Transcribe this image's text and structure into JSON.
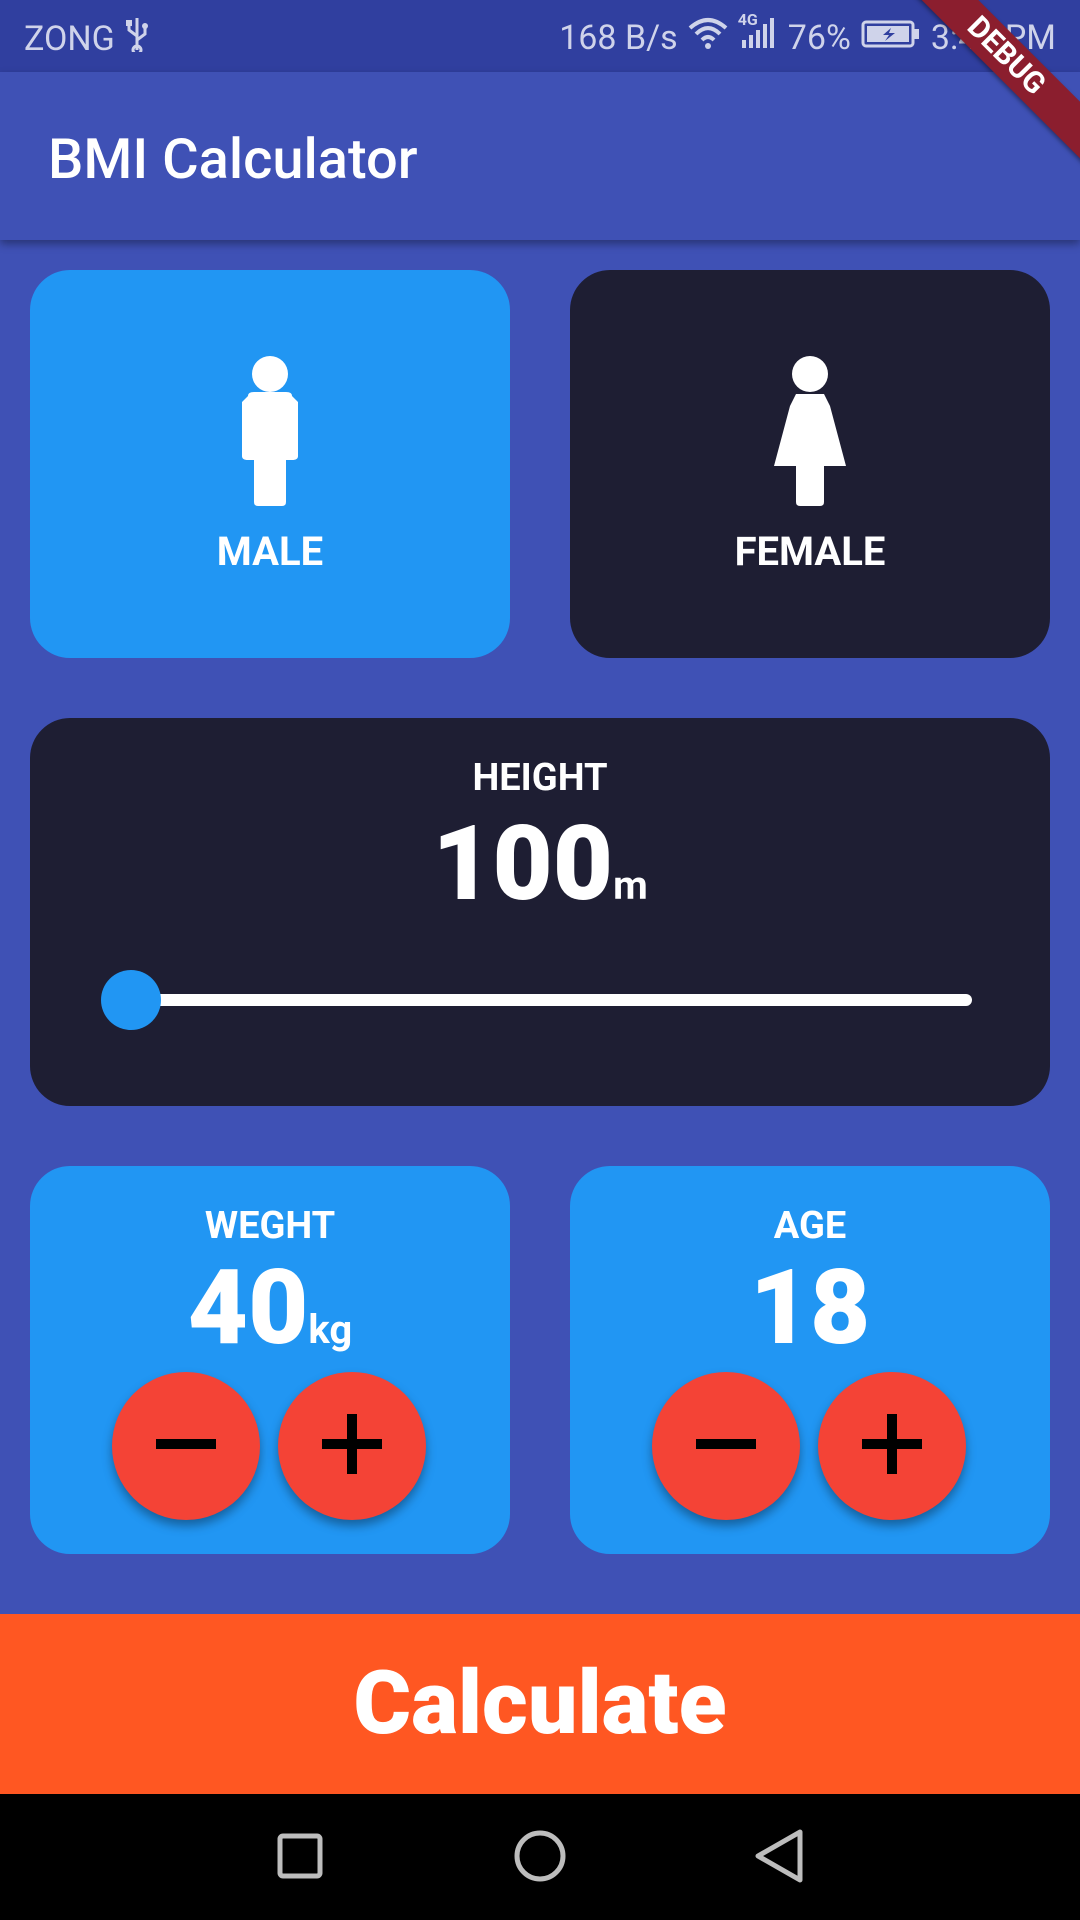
{
  "status_bar": {
    "carrier": "ZONG",
    "speed": "168 B/s",
    "network": "4G",
    "battery": "76%",
    "time": "3:48 PM"
  },
  "app_bar": {
    "title": "BMI Calculator",
    "debug_label": "DEBUG"
  },
  "gender": {
    "male_label": "MALE",
    "female_label": "FEMALE",
    "selected": "male"
  },
  "height": {
    "label": "HEIGHT",
    "value": "100",
    "unit": "m",
    "slider_fraction": 0
  },
  "weight": {
    "label": "WEGHT",
    "value": "40",
    "unit": "kg"
  },
  "age": {
    "label": "AGE",
    "value": "18"
  },
  "calculate_label": "Calculate",
  "colors": {
    "primary": "#3F51B5",
    "active_card": "#2196F3",
    "inactive_card": "#1E1E33",
    "round_button": "#F44336",
    "calculate_bg": "#FF5722"
  }
}
